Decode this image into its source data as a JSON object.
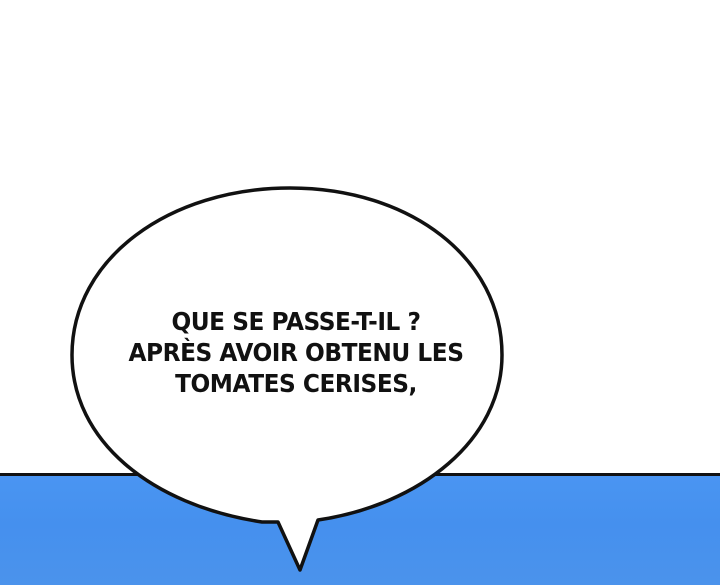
{
  "speech_bubble": {
    "lines": [
      "QUE SE PASSE-T-IL ?",
      "APRÈS AVOIR OBTENU LES",
      "TOMATES CERISES,"
    ]
  },
  "colors": {
    "background": "#ffffff",
    "sky": "#4590ee",
    "outline": "#111111"
  }
}
